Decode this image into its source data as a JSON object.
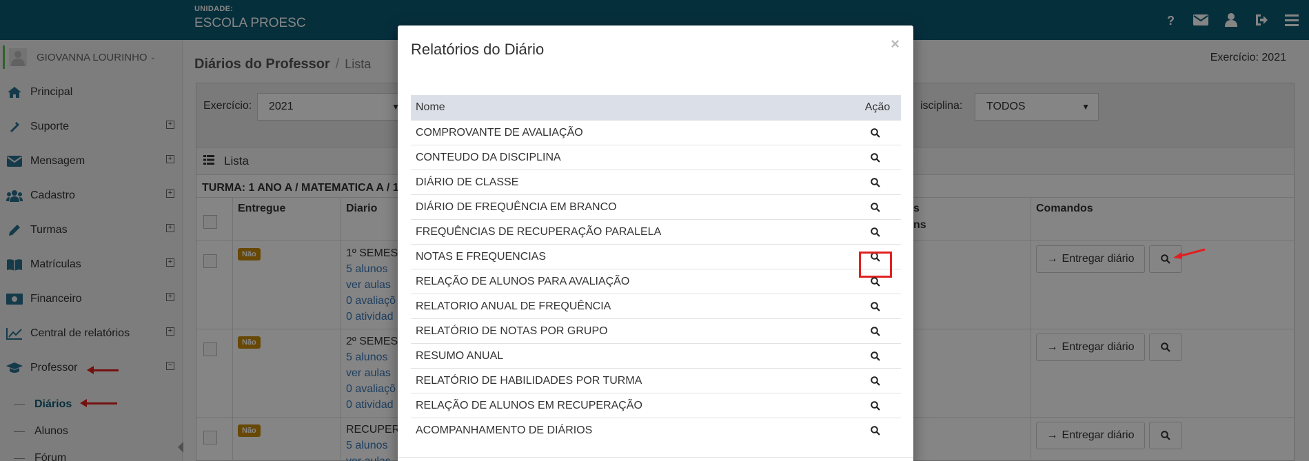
{
  "header": {
    "unit_label": "UNIDADE:",
    "unit_name": "ESCOLA PROESC",
    "icons": [
      "help-icon",
      "envelope-icon",
      "user-icon",
      "logout-icon",
      "menu-icon"
    ]
  },
  "sidebar": {
    "user_name": "GIOVANNA LOURINHO",
    "items": [
      {
        "label": "Principal",
        "icon": "home-icon"
      },
      {
        "label": "Suporte",
        "icon": "support-icon"
      },
      {
        "label": "Mensagem",
        "icon": "envelope-icon"
      },
      {
        "label": "Cadastro",
        "icon": "users-icon"
      },
      {
        "label": "Turmas",
        "icon": "pencil-icon"
      },
      {
        "label": "Matrículas",
        "icon": "book-icon"
      },
      {
        "label": "Financeiro",
        "icon": "money-icon"
      },
      {
        "label": "Central de relatórios",
        "icon": "chart-icon"
      },
      {
        "label": "Professor",
        "icon": "graduation-cap-icon"
      }
    ],
    "sub_items": [
      {
        "label": "Diários",
        "active": true
      },
      {
        "label": "Alunos",
        "active": false
      },
      {
        "label": "Fórum",
        "active": false
      }
    ]
  },
  "main": {
    "title": "Diários do Professor",
    "breadcrumb": "Lista",
    "exercise_top": "Exercício: 2021",
    "filters": {
      "exercicio_label": "Exercício:",
      "exercicio_value": "2021",
      "disciplina_label": "isciplina:",
      "disciplina_value": "TODOS"
    },
    "panel_title": "Lista",
    "turma": "TURMA: 1 ANO A / MATEMATICA A / 1",
    "columns": {
      "entregue": "Entregue",
      "diario": "Diario",
      "s": "s",
      "ns": "ns",
      "comandos": "Comandos"
    },
    "rows": [
      {
        "status": "Não",
        "title": "1º SEMES",
        "alunos": "5 alunos",
        "aulas": "ver aulas",
        "avaliacoes": "0 avaliaçõ",
        "atividades": "0 atividad",
        "button": "Entregar diário"
      },
      {
        "status": "Não",
        "title": "2º SEMES",
        "alunos": "5 alunos",
        "aulas": "ver aulas",
        "avaliacoes": "0 avaliaçõ",
        "atividades": "0 atividad",
        "button": "Entregar diário"
      },
      {
        "status": "Não",
        "title": "RECUPER",
        "alunos": "5 alunos",
        "aulas": "ver aulas",
        "avaliacoes": "",
        "atividades": "",
        "button": "Entregar diário"
      }
    ]
  },
  "modal": {
    "title": "Relatórios do Diário",
    "close": "×",
    "col_name": "Nome",
    "col_action": "Ação",
    "reports": [
      {
        "name": "COMPROVANTE DE AVALIAÇÃO",
        "highlighted": false
      },
      {
        "name": "CONTEUDO DA DISCIPLINA",
        "highlighted": false
      },
      {
        "name": "DIÁRIO DE CLASSE",
        "highlighted": false
      },
      {
        "name": "DIÁRIO DE FREQUÊNCIA EM BRANCO",
        "highlighted": false
      },
      {
        "name": "FREQUÊNCIAS DE RECUPERAÇÃO PARALELA",
        "highlighted": false
      },
      {
        "name": "NOTAS E FREQUENCIAS",
        "highlighted": true
      },
      {
        "name": "RELAÇÃO DE ALUNOS PARA AVALIAÇÃO",
        "highlighted": false
      },
      {
        "name": "RELATORIO ANUAL DE FREQUÊNCIA",
        "highlighted": false
      },
      {
        "name": "RELATÓRIO DE NOTAS POR GRUPO",
        "highlighted": false
      },
      {
        "name": "RESUMO ANUAL",
        "highlighted": false
      },
      {
        "name": "RELATÓRIO DE HABILIDADES POR TURMA",
        "highlighted": false
      },
      {
        "name": "RELAÇÃO DE ALUNOS EM RECUPERAÇÃO",
        "highlighted": false
      },
      {
        "name": "ACOMPANHAMENTO DE DIÁRIOS",
        "highlighted": false
      }
    ]
  },
  "colors": {
    "topbar": "#0d5a73",
    "annotation": "#e02020",
    "badge": "#c58a0a",
    "link": "#3a78b8"
  }
}
